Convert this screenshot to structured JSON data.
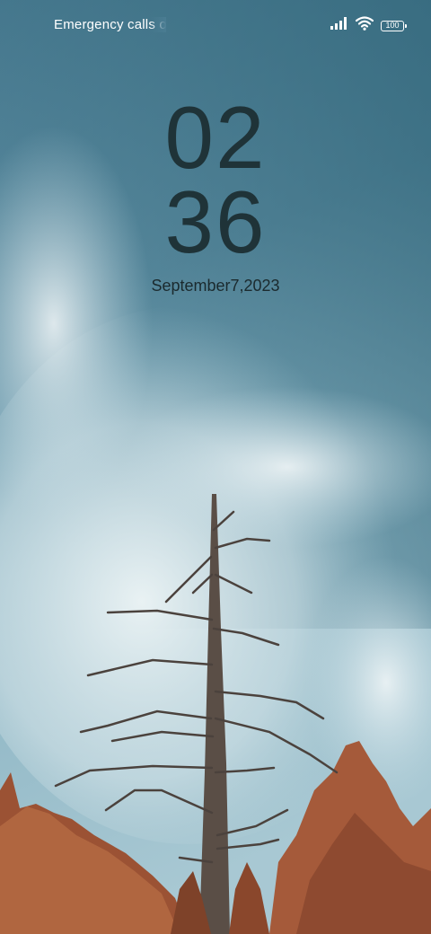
{
  "status_bar": {
    "carrier_text": "Emergency calls o",
    "signal_icon": "signal-bars-icon",
    "wifi_icon": "wifi-icon",
    "battery_level": "100"
  },
  "lock_screen": {
    "hour": "02",
    "minute": "36",
    "date": "September7,2023"
  },
  "wallpaper": {
    "description": "",
    "sky_top": "#3f7186",
    "sky_mid": "#6a9db0",
    "cloud": "#dfecef",
    "tree_foliage": "#a5583b",
    "trunk": "#5a4e46"
  }
}
